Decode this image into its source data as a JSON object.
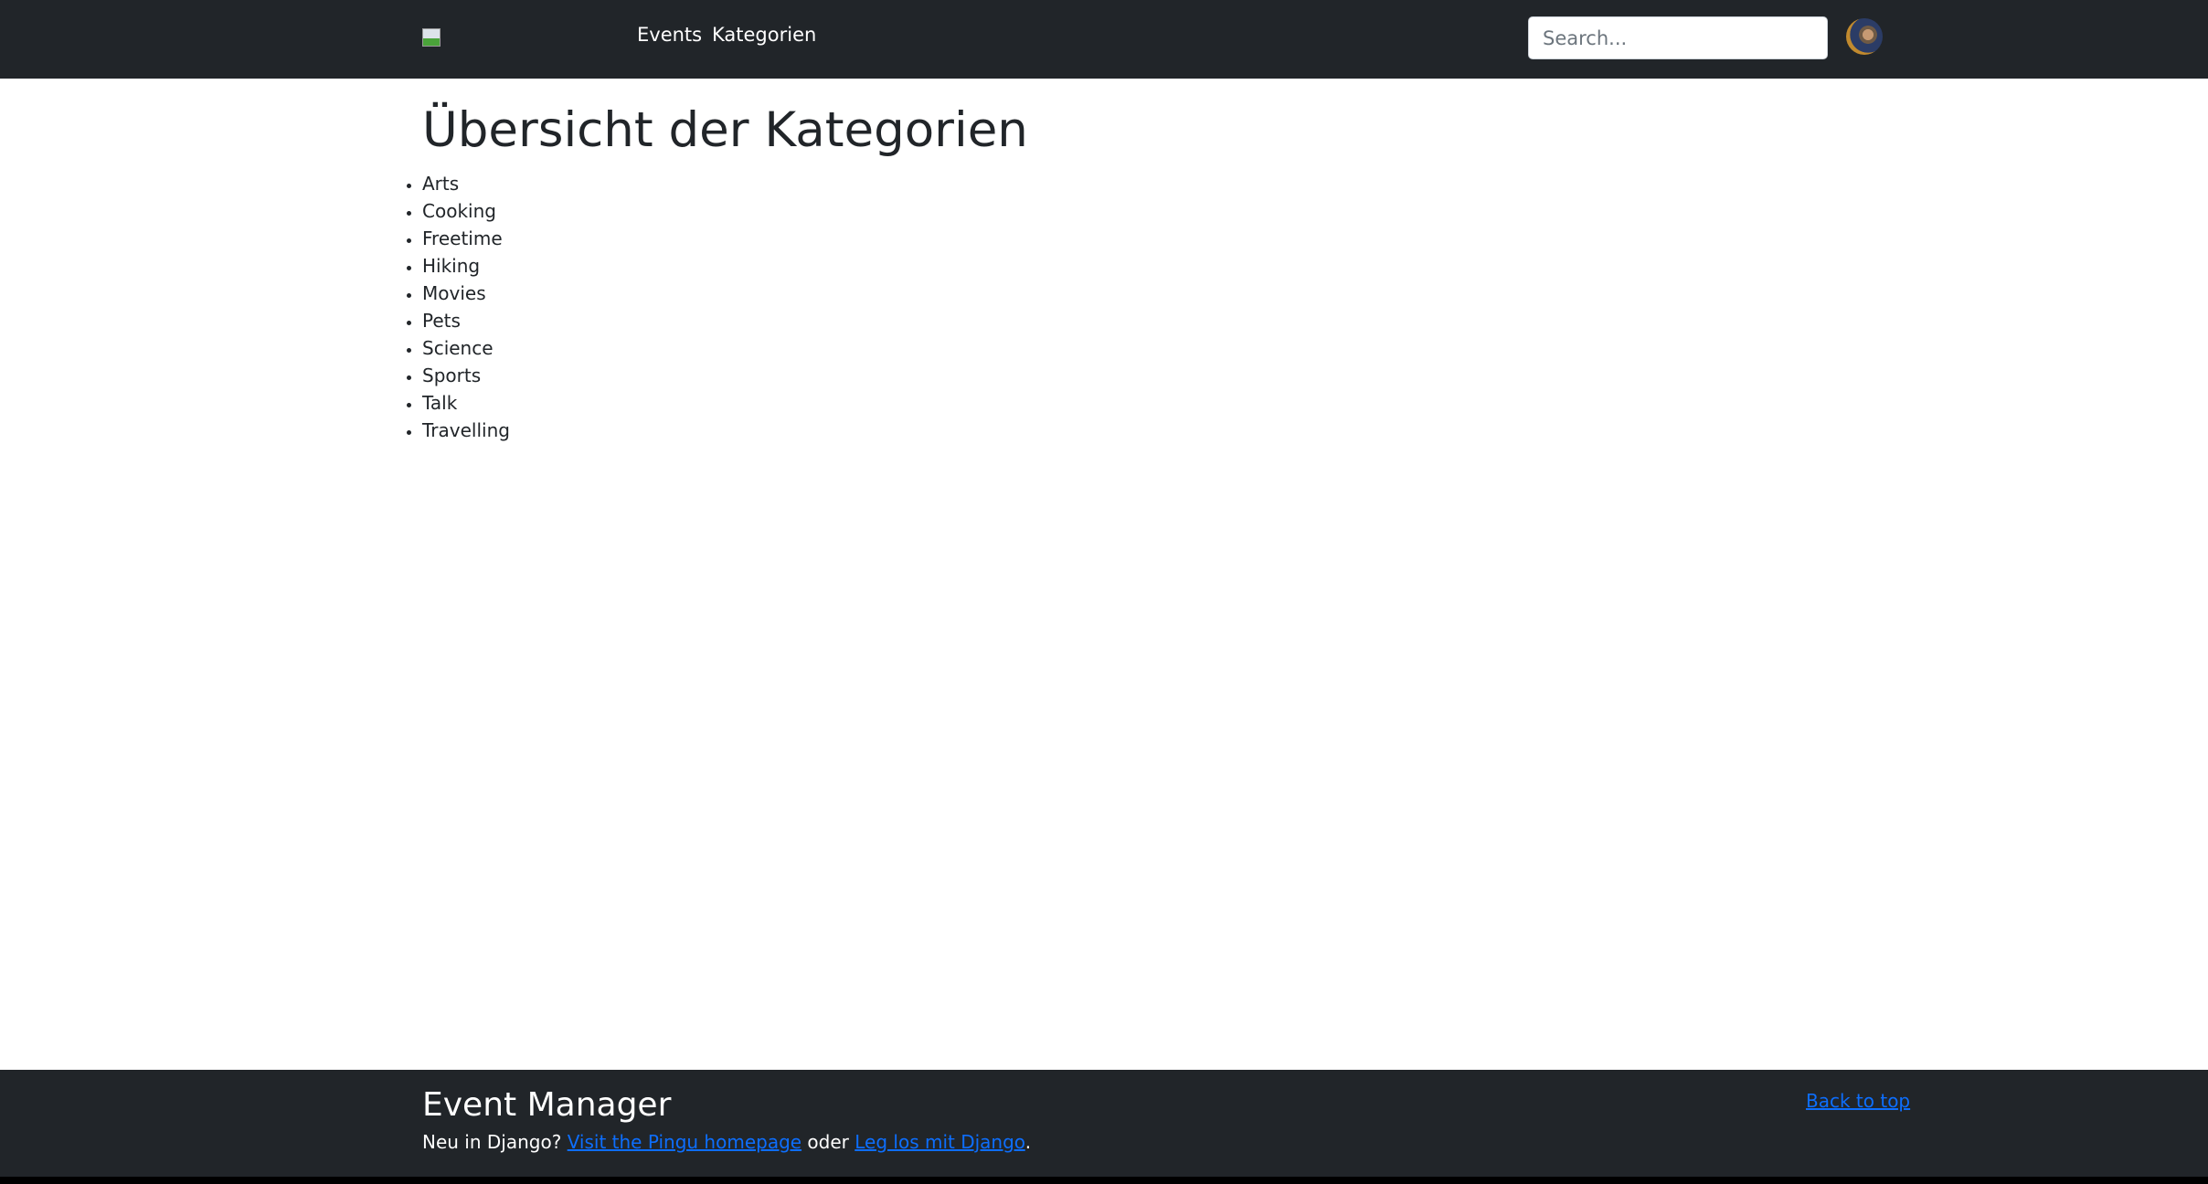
{
  "navbar": {
    "logo_icon": "broken-image-icon",
    "links": [
      "Events",
      "Kategorien"
    ],
    "search_placeholder": "Search...",
    "avatar_icon": "user-avatar"
  },
  "main": {
    "title": "Übersicht der Kategorien",
    "categories": [
      "Arts",
      "Cooking",
      "Freetime",
      "Hiking",
      "Movies",
      "Pets",
      "Science",
      "Sports",
      "Talk",
      "Travelling"
    ]
  },
  "footer": {
    "title": "Event Manager",
    "prefix": "Neu in Django? ",
    "link1": "Visit the Pingu homepage",
    "middle": " oder ",
    "link2": "Leg los mit Django",
    "suffix": ".",
    "back_to_top": "Back to top",
    "link_color": "#0d6efd"
  }
}
